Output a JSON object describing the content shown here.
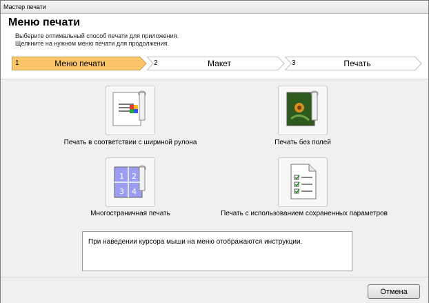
{
  "window": {
    "title": "Мастер печати"
  },
  "header": {
    "title": "Меню печати",
    "description_line1": "Выберите оптимальный способ печати для приложения.",
    "description_line2": "Щелкните на нужном меню печати для продолжения."
  },
  "steps": [
    {
      "number": "1",
      "label": "Меню печати",
      "active": true
    },
    {
      "number": "2",
      "label": "Макет",
      "active": false
    },
    {
      "number": "3",
      "label": "Печать",
      "active": false
    }
  ],
  "menu": [
    {
      "label": "Печать в соответствии с шириной рулона",
      "icon": "roll-width-print-icon"
    },
    {
      "label": "Печать без полей",
      "icon": "borderless-print-icon"
    },
    {
      "label": "Многостраничная печать",
      "icon": "multipage-print-icon"
    },
    {
      "label": "Печать с использованием сохраненных параметров",
      "icon": "saved-settings-print-icon"
    }
  ],
  "info_text": "При наведении курсора мыши на меню отображаются инструкции.",
  "footer": {
    "cancel_label": "Отмена"
  },
  "colors": {
    "active_step": "#fcc56a",
    "step_border": "#bdbdbd"
  }
}
